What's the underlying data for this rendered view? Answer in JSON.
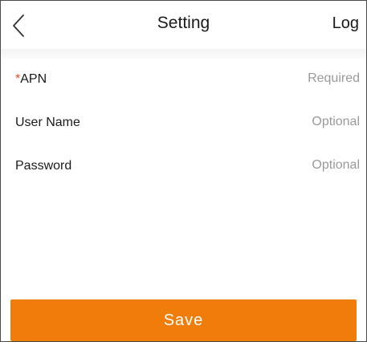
{
  "header": {
    "back_icon": "chevron-left-icon",
    "title": "Setting",
    "log_label": "Log"
  },
  "form": {
    "fields": [
      {
        "label": "APN",
        "required_mark": "*",
        "value": "",
        "placeholder": "Required"
      },
      {
        "label": "User Name",
        "value": "",
        "placeholder": "Optional"
      },
      {
        "label": "Password",
        "value": "",
        "placeholder": "Optional"
      }
    ]
  },
  "actions": {
    "save_label": "Save"
  },
  "colors": {
    "accent": "#f07c0a",
    "required": "#e8462f",
    "placeholder": "#9a9a9a"
  }
}
